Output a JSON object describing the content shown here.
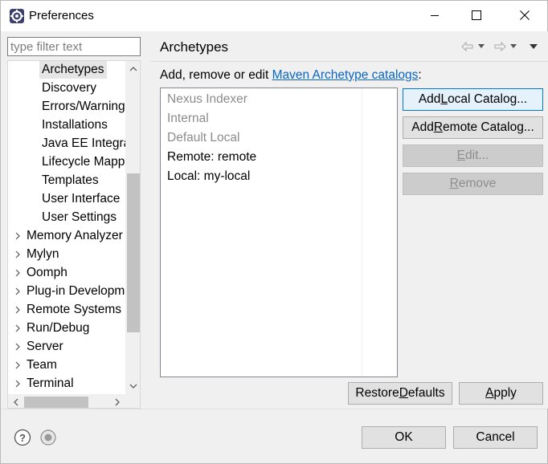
{
  "window": {
    "title": "Preferences",
    "icon": "eclipse-gear-icon",
    "controls": [
      "minimize-icon",
      "maximize-icon",
      "close-icon"
    ]
  },
  "filter": {
    "placeholder": "type filter text",
    "value": ""
  },
  "tree": {
    "children": [
      {
        "label": "Archetypes",
        "selected": true
      },
      {
        "label": "Discovery"
      },
      {
        "label": "Errors/Warnings"
      },
      {
        "label": "Installations"
      },
      {
        "label": "Java EE Integration"
      },
      {
        "label": "Lifecycle Mappings"
      },
      {
        "label": "Templates"
      },
      {
        "label": "User Interface"
      },
      {
        "label": "User Settings"
      }
    ],
    "top_level": [
      {
        "label": "Memory Analyzer"
      },
      {
        "label": "Mylyn"
      },
      {
        "label": "Oomph"
      },
      {
        "label": "Plug-in Development"
      },
      {
        "label": "Remote Systems"
      },
      {
        "label": "Run/Debug"
      },
      {
        "label": "Server"
      },
      {
        "label": "Team"
      },
      {
        "label": "Terminal"
      }
    ]
  },
  "page": {
    "title": "Archetypes",
    "description_prefix": "Add, remove or edit ",
    "description_link": "Maven Archetype catalogs",
    "description_suffix": ":",
    "nav_tools": [
      "back-arrow-icon",
      "back-dropdown-icon",
      "forward-arrow-icon",
      "forward-dropdown-icon",
      "view-menu-icon"
    ]
  },
  "catalogs": [
    {
      "label": "Nexus Indexer",
      "enabled": false
    },
    {
      "label": "Internal",
      "enabled": false
    },
    {
      "label": "Default Local",
      "enabled": false
    },
    {
      "label": "Remote: remote",
      "enabled": true
    },
    {
      "label": "Local: my-local",
      "enabled": true
    }
  ],
  "buttons": {
    "add_local": {
      "pre": "Add ",
      "mn": "L",
      "post": "ocal Catalog..."
    },
    "add_remote": {
      "pre": "Add ",
      "mn": "R",
      "post": "emote Catalog..."
    },
    "edit": {
      "pre": "",
      "mn": "E",
      "post": "dit..."
    },
    "remove": {
      "pre": "",
      "mn": "R",
      "post": "emove"
    },
    "restore_defaults": {
      "pre": "Restore ",
      "mn": "D",
      "post": "efaults"
    },
    "apply": {
      "pre": "",
      "mn": "A",
      "post": "pply"
    },
    "ok": "OK",
    "cancel": "Cancel"
  },
  "footer_icons": [
    "help-icon",
    "oomph-record-icon"
  ]
}
